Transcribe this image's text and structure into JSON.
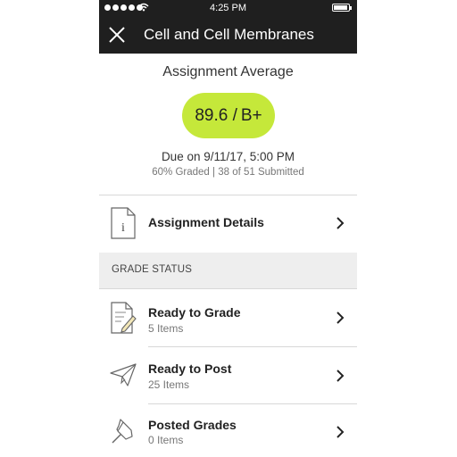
{
  "status_bar": {
    "time": "4:25 PM"
  },
  "header": {
    "title": "Cell and Cell Membranes",
    "close_icon": "close-icon"
  },
  "summary": {
    "average_label": "Assignment Average",
    "score": "89.6 /",
    "letter_grade": "B+",
    "pill_color": "#c5e83a",
    "due": "Due on 9/11/17, 5:00 PM",
    "graded_percent": "60% Graded",
    "separator": "|",
    "submitted": "38 of 51 Submitted"
  },
  "details_row": {
    "label": "Assignment Details",
    "icon": "info-document-icon"
  },
  "grade_status": {
    "section_label": "GRADE STATUS",
    "items": [
      {
        "title": "Ready to Grade",
        "count": "5 Items",
        "icon": "document-pencil-icon"
      },
      {
        "title": "Ready to Post",
        "count": "25 Items",
        "icon": "paper-plane-icon"
      },
      {
        "title": "Posted Grades",
        "count": "0 Items",
        "icon": "pushpin-icon"
      }
    ]
  },
  "colors": {
    "header_bg": "#1f1f1f",
    "section_bg": "#eeeeee",
    "accent": "#c5e83a"
  }
}
